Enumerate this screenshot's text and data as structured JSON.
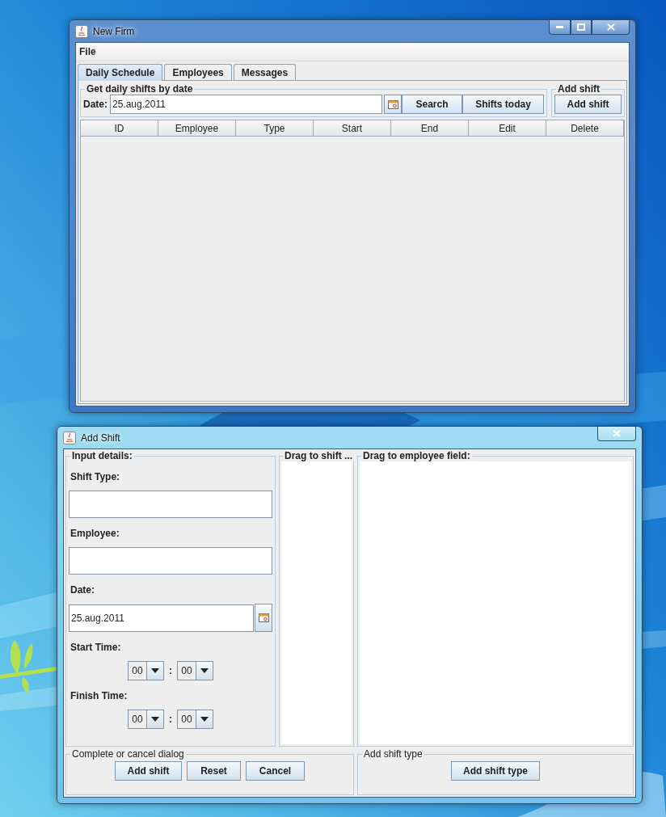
{
  "main_window": {
    "title": "New Firm",
    "menu": [
      "File"
    ],
    "tabs": [
      {
        "label": "Daily Schedule",
        "selected": true
      },
      {
        "label": "Employees",
        "selected": false
      },
      {
        "label": "Messages",
        "selected": false
      }
    ],
    "date_group": {
      "title": "Get daily shifts by date",
      "date_label": "Date:",
      "date_value": "25.aug.2011",
      "buttons": [
        "Search",
        "Shifts today"
      ]
    },
    "add_group": {
      "title": "Add shift",
      "button": "Add shift"
    },
    "table": {
      "columns": [
        "ID",
        "Employee",
        "Type",
        "Start",
        "End",
        "Edit",
        "Delete"
      ]
    }
  },
  "dialog": {
    "title": "Add Shift",
    "input_group": {
      "title": "Input details:",
      "fields": [
        {
          "kind": "text",
          "label": "Shift Type:"
        },
        {
          "kind": "text",
          "label": "Employee:"
        },
        {
          "kind": "date",
          "label": "Date:",
          "value": "25.aug.2011"
        },
        {
          "kind": "time",
          "label": "Start Time:",
          "hour": "00",
          "separator": ":",
          "minute": "00"
        },
        {
          "kind": "time",
          "label": "Finish Time:",
          "hour": "00",
          "separator": ":",
          "minute": "00"
        }
      ]
    },
    "shift_list": {
      "title": "Drag to shift ..."
    },
    "employee_list": {
      "title": "Drag to employee field:"
    },
    "complete_group": {
      "title": "Complete or cancel dialog",
      "buttons": [
        "Add shift",
        "Reset",
        "Cancel"
      ]
    },
    "type_group": {
      "title": "Add shift type",
      "button": "Add shift type"
    }
  }
}
